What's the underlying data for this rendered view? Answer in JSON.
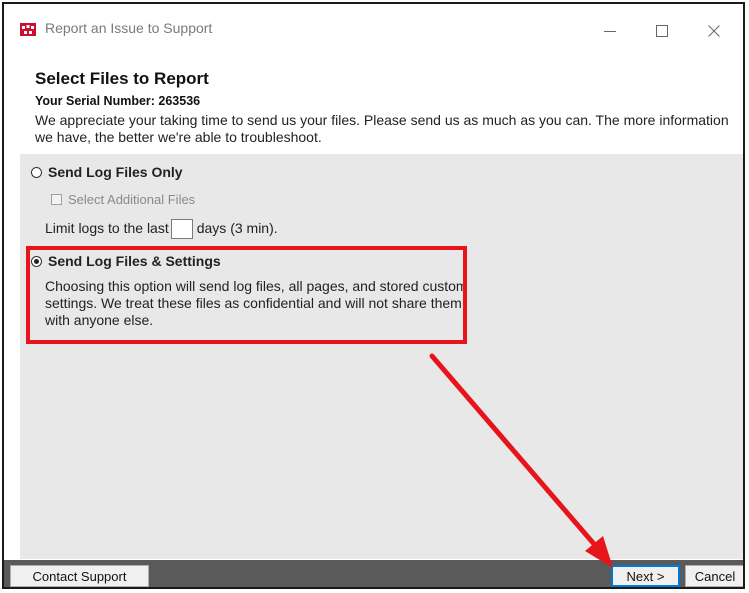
{
  "window": {
    "title": "Report an Issue to Support",
    "controls": {
      "minimize": "—",
      "maximize": "☐",
      "close": "✕"
    }
  },
  "header": {
    "title": "Select Files to Report",
    "serial": "Your Serial Number: 263536",
    "description": "We appreciate your taking time to send us your files. Please send us as much as you can. The more information we have, the better we're able to troubleshoot."
  },
  "options": {
    "log_only": {
      "label": "Send Log Files Only",
      "selected": false
    },
    "additional_files": {
      "label": "Select Additional Files",
      "checked": false,
      "enabled": false
    },
    "limit": {
      "prefix": "Limit logs to the last",
      "value": "",
      "suffix": "days (3 min)."
    },
    "log_settings": {
      "label": "Send Log Files & Settings",
      "selected": true,
      "description": "Choosing this option will send log files, all pages, and stored custom settings. We treat these files as confidential and will not share them with anyone else."
    }
  },
  "footer": {
    "contact_label": "Contact Support",
    "next_label": "Next >",
    "cancel_label": "Cancel"
  },
  "colors": {
    "annotation": "#e8141b",
    "focus": "#0078d7",
    "footer_bg": "#5a5a5a",
    "content_bg": "#e8e8e8"
  }
}
